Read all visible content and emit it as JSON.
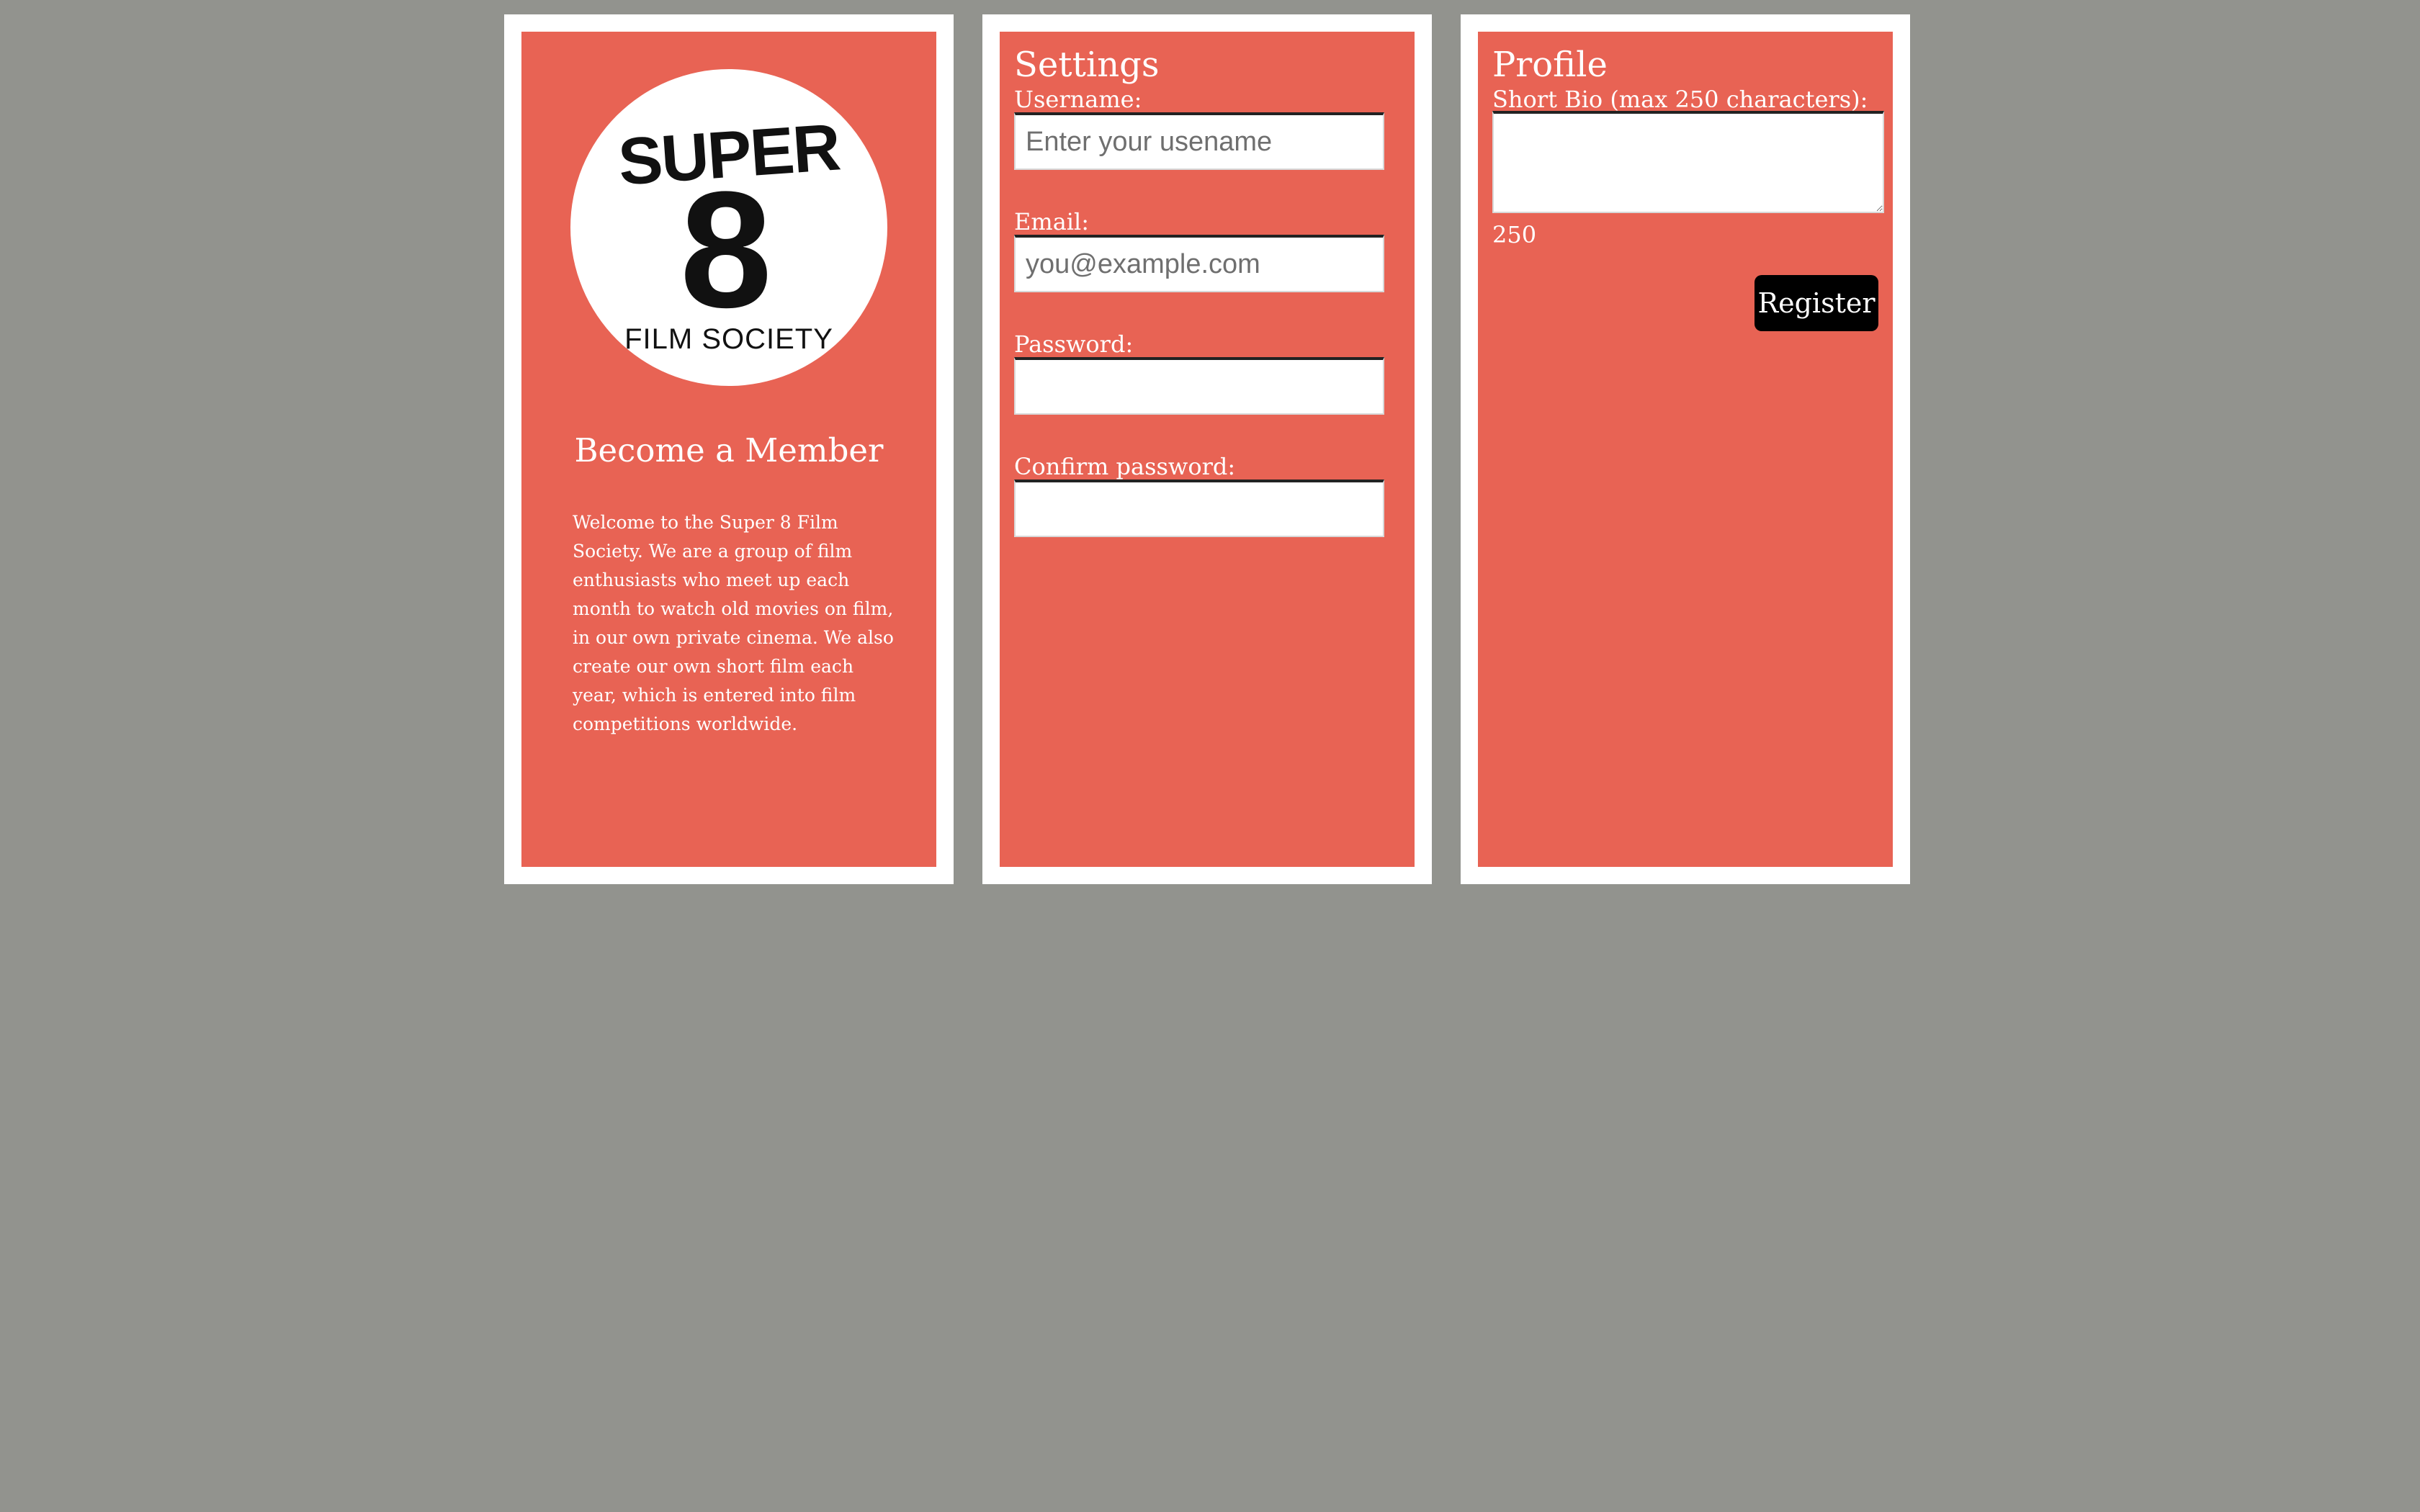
{
  "about": {
    "logo_alt": "Super 8 Film Society",
    "logo_text_top": "SUPER",
    "logo_text_number": "8",
    "logo_text_bottom": "FILM SOCIETY",
    "title": "Become a Member",
    "description": "Welcome to the Super 8 Film Society. We are a group of film enthusiasts who meet up each month to watch old movies on film, in our own private cinema. We also create our own short film each year, which is entered into film competitions worldwide."
  },
  "settings": {
    "title": "Settings",
    "username_label": "Username:",
    "username_placeholder": "Enter your usename",
    "email_label": "Email:",
    "email_placeholder": "you@example.com",
    "password_label": "Password:",
    "confirm_password_label": "Confirm password:"
  },
  "profile": {
    "title": "Profile",
    "bio_label": "Short Bio (max 250 characters):",
    "bio_value": "",
    "char_count": "250",
    "register_label": "Register"
  },
  "colors": {
    "page_background": "#92938e",
    "card_border": "#ffffff",
    "card_fill": "#e86354",
    "button": "#000000"
  }
}
